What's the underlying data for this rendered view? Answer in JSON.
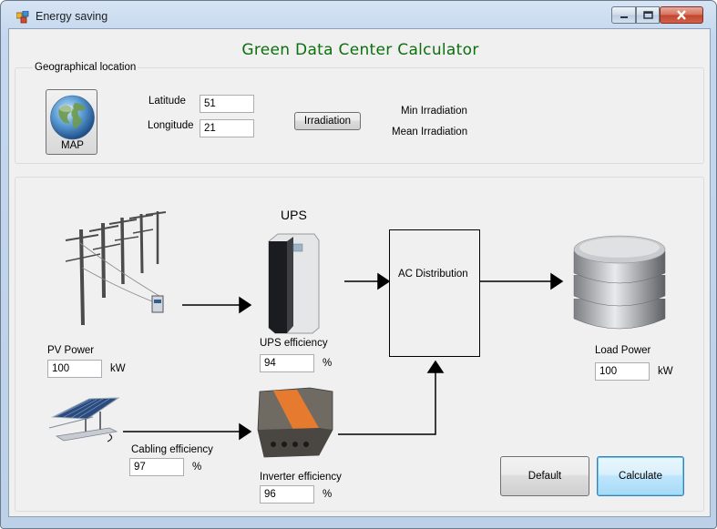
{
  "window": {
    "title": "Energy saving",
    "controls": {
      "minimize": "—",
      "maximize": "☐",
      "close": "✕"
    }
  },
  "heading": "Green Data Center Calculator",
  "geo": {
    "group_label": "Geographical location",
    "map_button": "MAP",
    "latitude_label": "Latitude",
    "latitude_value": "51",
    "longitude_label": "Longitude",
    "longitude_value": "21",
    "irradiation_button": "Irradiation",
    "min_irradiation_label": "Min Irradiation",
    "mean_irradiation_label": "Mean Irradiation"
  },
  "diagram": {
    "ups_title": "UPS",
    "pv_power_label": "PV Power",
    "pv_power_value": "100",
    "pv_power_unit": "kW",
    "ups_efficiency_label": "UPS efficiency",
    "ups_efficiency_value": "94",
    "ups_efficiency_unit": "%",
    "ac_distribution_label": "AC Distribution",
    "load_power_label": "Load Power",
    "load_power_value": "100",
    "load_power_unit": "kW",
    "cabling_efficiency_label": "Cabling efficiency",
    "cabling_efficiency_value": "97",
    "cabling_efficiency_unit": "%",
    "inverter_efficiency_label": "Inverter efficiency",
    "inverter_efficiency_value": "96",
    "inverter_efficiency_unit": "%"
  },
  "buttons": {
    "default": "Default",
    "calculate": "Calculate"
  },
  "colors": {
    "heading": "#0d6f0d",
    "client_bg": "#f0f0f0",
    "focus_border": "#3c7fb1"
  }
}
